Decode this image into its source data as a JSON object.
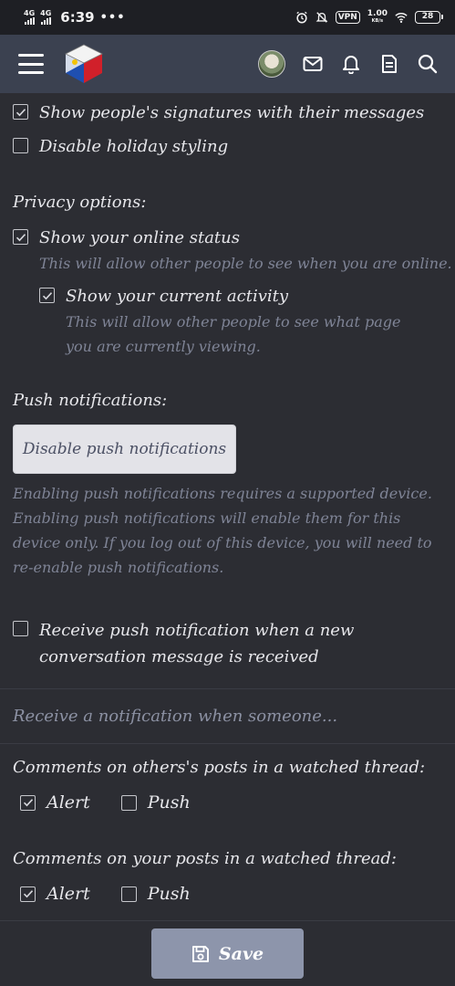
{
  "status_bar": {
    "signal_1": "4G",
    "signal_2": "4G",
    "time": "6:39",
    "dots": "•••",
    "vpn": "VPN",
    "net_speed": "1.00",
    "net_unit": "KB/s",
    "battery": "28"
  },
  "header": {
    "icons": [
      "hamburger-menu-icon",
      "site-logo",
      "avatar",
      "envelope-icon",
      "bell-icon",
      "document-icon",
      "search-icon"
    ]
  },
  "options": {
    "signatures": {
      "label": "Show people's signatures with their messages",
      "checked": true
    },
    "holiday": {
      "label": "Disable holiday styling",
      "checked": false
    }
  },
  "privacy": {
    "title": "Privacy options:",
    "online_status": {
      "label": "Show your online status",
      "hint": "This will allow other people to see when you are online.",
      "checked": true
    },
    "current_activity": {
      "label": "Show your current activity",
      "hint": "This will allow other people to see what page you are currently viewing.",
      "checked": true
    }
  },
  "push": {
    "title": "Push notifications:",
    "button": "Disable push notifications",
    "description": "Enabling push notifications requires a supported device. Enabling push notifications will enable them for this device only. If you log out of this device, you will need to re-enable push notifications.",
    "conversation": {
      "label": "Receive push notification when a new conversation message is received",
      "checked": false
    }
  },
  "notify": {
    "heading": "Receive a notification when someone...",
    "others_posts": {
      "title": "Comments on others's posts in a watched thread:",
      "alert": {
        "label": "Alert",
        "checked": true
      },
      "push": {
        "label": "Push",
        "checked": false
      }
    },
    "your_posts": {
      "title": "Comments on your posts in a watched thread:",
      "alert": {
        "label": "Alert",
        "checked": true
      },
      "push": {
        "label": "Push",
        "checked": false
      }
    }
  },
  "footer": {
    "save": "Save"
  },
  "colors": {
    "background": "#2c2d33",
    "header": "#3b4150",
    "save_button": "#8d95ab",
    "hint_text": "#7f8496"
  }
}
